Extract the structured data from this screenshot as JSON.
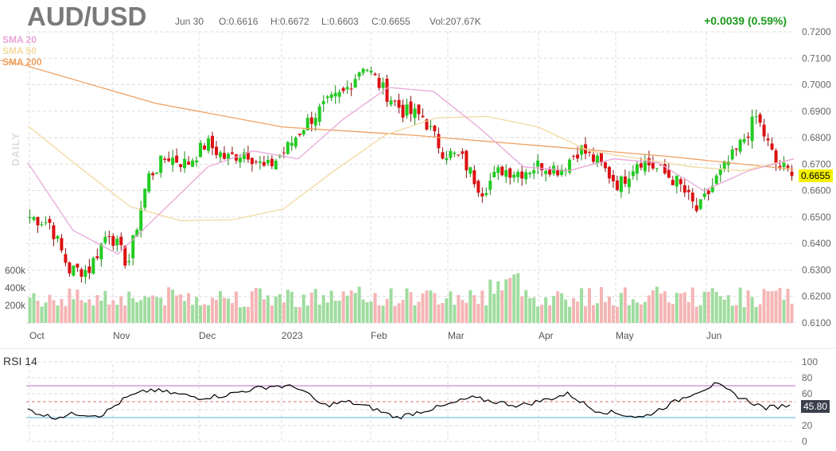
{
  "header": {
    "symbol": "AUD/USD",
    "date": "Jun 30",
    "open": "O:0.6616",
    "high": "H:0.6672",
    "low": "L:0.6603",
    "close": "C:0.6655",
    "volume": "Vol:207.67K",
    "change": "+0.0039 (0.59%)"
  },
  "legend": {
    "sma20": "SMA 20",
    "sma50": "SMA 50",
    "sma200": "SMA 200",
    "period": "DAILY",
    "rsi": "RSI 14"
  },
  "colors": {
    "up": "#22cc22",
    "down": "#dd1111",
    "vol_up": "#9fdc9f",
    "vol_down": "#f5b5b5",
    "sma20": "#e8a6d8",
    "sma50": "#f2d9a0",
    "sma200": "#f0a060",
    "rsi": "#000000",
    "overbought": "#b86cc8",
    "oversold": "#5ab4dc",
    "price_tag": "#f5f200"
  },
  "chart_data": [
    {
      "type": "candlestick",
      "title": "AUD/USD Daily",
      "ylim": [
        0.61,
        0.72
      ],
      "yticks": [
        "0.7200",
        "0.7100",
        "0.7000",
        "0.6900",
        "0.6800",
        "0.6700",
        "0.6600",
        "0.6500",
        "0.6400",
        "0.6300",
        "0.6200",
        "0.6100"
      ],
      "xticks": [
        "Oct",
        "Nov",
        "Dec",
        "2023",
        "Feb",
        "Mar",
        "Apr",
        "May",
        "Jun"
      ],
      "current_price": "0.6655",
      "start_price": 0.65,
      "weekly_closes": [
        0.648,
        0.63,
        0.63,
        0.645,
        0.632,
        0.665,
        0.673,
        0.67,
        0.678,
        0.672,
        0.675,
        0.668,
        0.675,
        0.685,
        0.692,
        0.697,
        0.708,
        0.698,
        0.69,
        0.688,
        0.675,
        0.672,
        0.66,
        0.668,
        0.667,
        0.67,
        0.668,
        0.676,
        0.67,
        0.662,
        0.672,
        0.668,
        0.663,
        0.652,
        0.665,
        0.675,
        0.688,
        0.67,
        0.6655
      ],
      "sma20": [
        0.6705,
        0.645,
        0.636,
        0.6525,
        0.669,
        0.675,
        0.672,
        0.687,
        0.699,
        0.6975,
        0.684,
        0.669,
        0.6675,
        0.672,
        0.6705,
        0.66,
        0.6675,
        0.672
      ],
      "sma50": [
        0.6845,
        0.669,
        0.654,
        0.6486,
        0.649,
        0.653,
        0.6675,
        0.681,
        0.6875,
        0.688,
        0.684,
        0.675,
        0.672,
        0.669,
        0.6675,
        0.672
      ],
      "sma200": [
        0.707,
        0.693,
        0.684,
        0.681,
        0.677,
        0.673,
        0.668
      ]
    },
    {
      "type": "bar",
      "title": "Volume",
      "yticks": [
        "600k",
        "400k",
        "200k"
      ],
      "ylim": [
        0,
        650000
      ],
      "typical_volume": 300000
    },
    {
      "type": "line",
      "title": "RSI 14",
      "ylim": [
        0,
        100
      ],
      "yticks": [
        "100",
        "80",
        "60",
        "40",
        "20",
        "0"
      ],
      "levels": [
        70,
        50,
        30
      ],
      "values": [
        40,
        30,
        35,
        33,
        55,
        65,
        60,
        55,
        58,
        65,
        70,
        68,
        45,
        50,
        42,
        30,
        38,
        45,
        55,
        50,
        45,
        52,
        60,
        40,
        35,
        30,
        45,
        60,
        72,
        55,
        42,
        45.8
      ],
      "current": "45.80"
    }
  ]
}
